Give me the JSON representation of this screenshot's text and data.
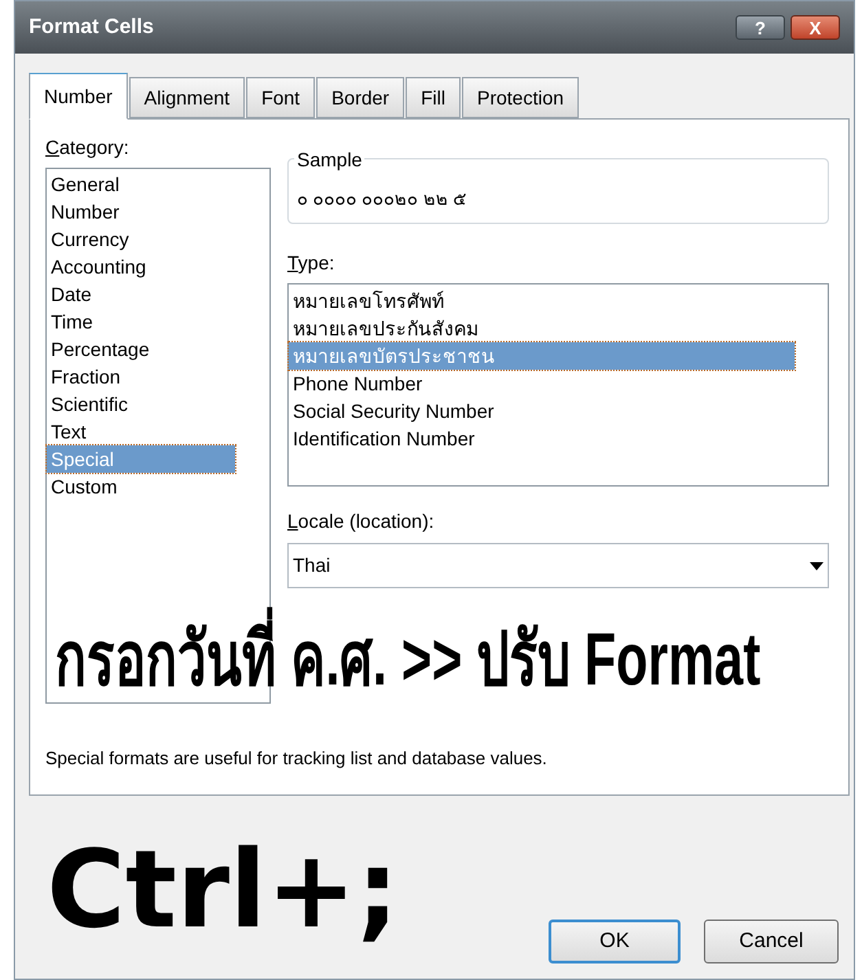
{
  "window": {
    "title": "Format Cells",
    "controls": [
      "?",
      "X"
    ]
  },
  "tabs": [
    {
      "label": "Number",
      "selected": true
    },
    {
      "label": "Alignment",
      "selected": false
    },
    {
      "label": "Font",
      "selected": false
    },
    {
      "label": "Border",
      "selected": false
    },
    {
      "label": "Fill",
      "selected": false
    },
    {
      "label": "Protection",
      "selected": false
    }
  ],
  "category": {
    "label": "Category:",
    "items": [
      {
        "label": "General",
        "selected": false
      },
      {
        "label": "Number",
        "selected": false
      },
      {
        "label": "Currency",
        "selected": false
      },
      {
        "label": "Accounting",
        "selected": false
      },
      {
        "label": "Date",
        "selected": false
      },
      {
        "label": "Time",
        "selected": false
      },
      {
        "label": "Percentage",
        "selected": false
      },
      {
        "label": "Fraction",
        "selected": false
      },
      {
        "label": "Scientific",
        "selected": false
      },
      {
        "label": "Text",
        "selected": false
      },
      {
        "label": "Special",
        "selected": true
      },
      {
        "label": "Custom",
        "selected": false
      }
    ]
  },
  "sample": {
    "label": "Sample",
    "value": "๐ ๐๐๐๐ ๐๐๐๒๐ ๒๒ ๕"
  },
  "type": {
    "label": "Type:",
    "items": [
      {
        "label": "หมายเลขโทรศัพท์",
        "selected": false
      },
      {
        "label": "หมายเลขประกันสังคม",
        "selected": false
      },
      {
        "label": "หมายเลขบัตรประชาชน",
        "selected": true
      },
      {
        "label": "Phone Number",
        "selected": false
      },
      {
        "label": "Social Security Number",
        "selected": false
      },
      {
        "label": "Identification Number",
        "selected": false
      }
    ]
  },
  "locale": {
    "label": "Locale (location):",
    "value": "Thai"
  },
  "overlay_caption": "กรอกวันที่ ค.ศ. >> ปรับ Format",
  "description": "Special formats are useful for tracking list and database values.",
  "shortcut_caption": "Ctrl+;",
  "buttons": [
    "OK",
    "Cancel"
  ]
}
